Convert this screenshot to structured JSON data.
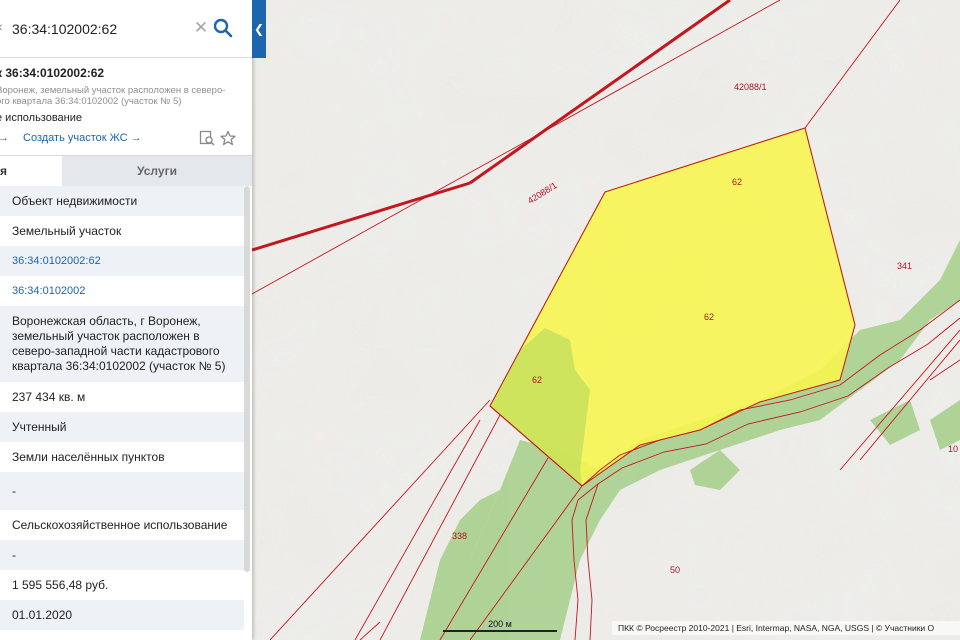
{
  "search": {
    "value": "36:34:102002:62"
  },
  "object": {
    "title": "к 36:34:0102002:62",
    "subtitle": "Воронеж, земельный участок расположен в северо-\nого квартала 36:34:0102002 (участок № 5)",
    "usage": "е использование",
    "link_arrow": "→",
    "link_create": "Создать участок ЖС →"
  },
  "tabs": {
    "info": "я",
    "services": "Услуги"
  },
  "rows": [
    "Объект недвижимости",
    "Земельный участок",
    "36:34:0102002:62",
    "36:34:0102002",
    "Воронежская область, г Воронеж, земельный участок расположен в северо-западной части кадастрового квартала 36:34:0102002 (участок № 5)",
    "237 434 кв. м",
    "Учтенный",
    "Земли населённых пунктов",
    "-",
    "Сельскохозяйственное использование",
    "-",
    "1 595 556,48 руб.",
    "01.01.2020"
  ],
  "map_labels": {
    "road_top": "42088/1",
    "road_diag": "42088/1",
    "parcel_top": "62",
    "parcel_mid": "62",
    "parcel_left": "62",
    "n341": "341",
    "n338": "338",
    "n50": "50",
    "n10": "10"
  },
  "scale": "200 м",
  "attribution": "ПКК © Росреестр 2010-2021 | Esri, Intermap, NASA, NGA, USGS | © Участники O",
  "colors": {
    "accent": "#1d65ae",
    "parcel_fill": "#f7f64d",
    "boundary": "#c4161f",
    "forest": "#a9d08f"
  },
  "icons": {
    "search": "search-icon",
    "clear": "close-icon",
    "collapse": "chevron-left-icon",
    "print": "print-icon",
    "favorite": "star-icon"
  }
}
